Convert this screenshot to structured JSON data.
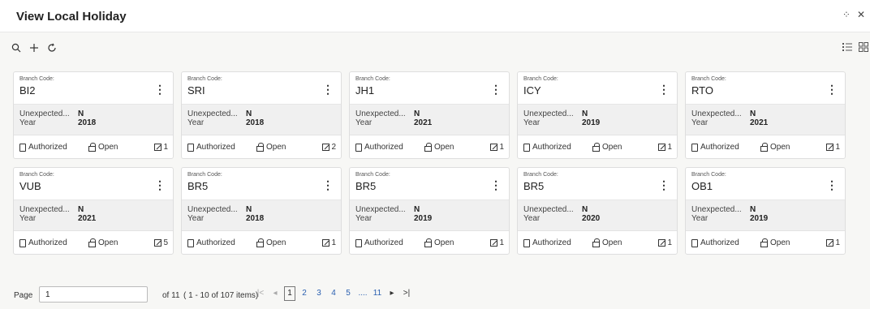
{
  "header": {
    "title": "View Local Holiday",
    "icons": [
      "collapse-icon",
      "close-icon"
    ]
  },
  "toolbar": {
    "icons": [
      "search-icon",
      "add-icon",
      "refresh-icon"
    ],
    "view_icons": [
      "list-view-icon",
      "grid-view-icon"
    ]
  },
  "card_labels": {
    "branch_code": "Branch Code:",
    "unexpected": "Unexpected...",
    "year": "Year",
    "authorized": "Authorized",
    "open": "Open"
  },
  "cards": [
    {
      "branch_code": "BI2",
      "unexpected": "N",
      "year": "2018",
      "edits": "1"
    },
    {
      "branch_code": "SRI",
      "unexpected": "N",
      "year": "2018",
      "edits": "2"
    },
    {
      "branch_code": "JH1",
      "unexpected": "N",
      "year": "2021",
      "edits": "1"
    },
    {
      "branch_code": "ICY",
      "unexpected": "N",
      "year": "2019",
      "edits": "1"
    },
    {
      "branch_code": "RTO",
      "unexpected": "N",
      "year": "2021",
      "edits": "1"
    },
    {
      "branch_code": "VUB",
      "unexpected": "N",
      "year": "2021",
      "edits": "5"
    },
    {
      "branch_code": "BR5",
      "unexpected": "N",
      "year": "2018",
      "edits": "1"
    },
    {
      "branch_code": "BR5",
      "unexpected": "N",
      "year": "2019",
      "edits": "1"
    },
    {
      "branch_code": "BR5",
      "unexpected": "N",
      "year": "2020",
      "edits": "1"
    },
    {
      "branch_code": "OB1",
      "unexpected": "N",
      "year": "2019",
      "edits": "1"
    }
  ],
  "pagination": {
    "page_label": "Page",
    "page_value": "1",
    "of_label": "of 11",
    "range_text": "( 1 - 10 of 107 items)",
    "pages": [
      "1",
      "2",
      "3",
      "4",
      "5",
      "....",
      "11"
    ],
    "first_icon": "|<",
    "prev_icon": "◂",
    "next_icon": "▸",
    "last_icon": ">|"
  }
}
